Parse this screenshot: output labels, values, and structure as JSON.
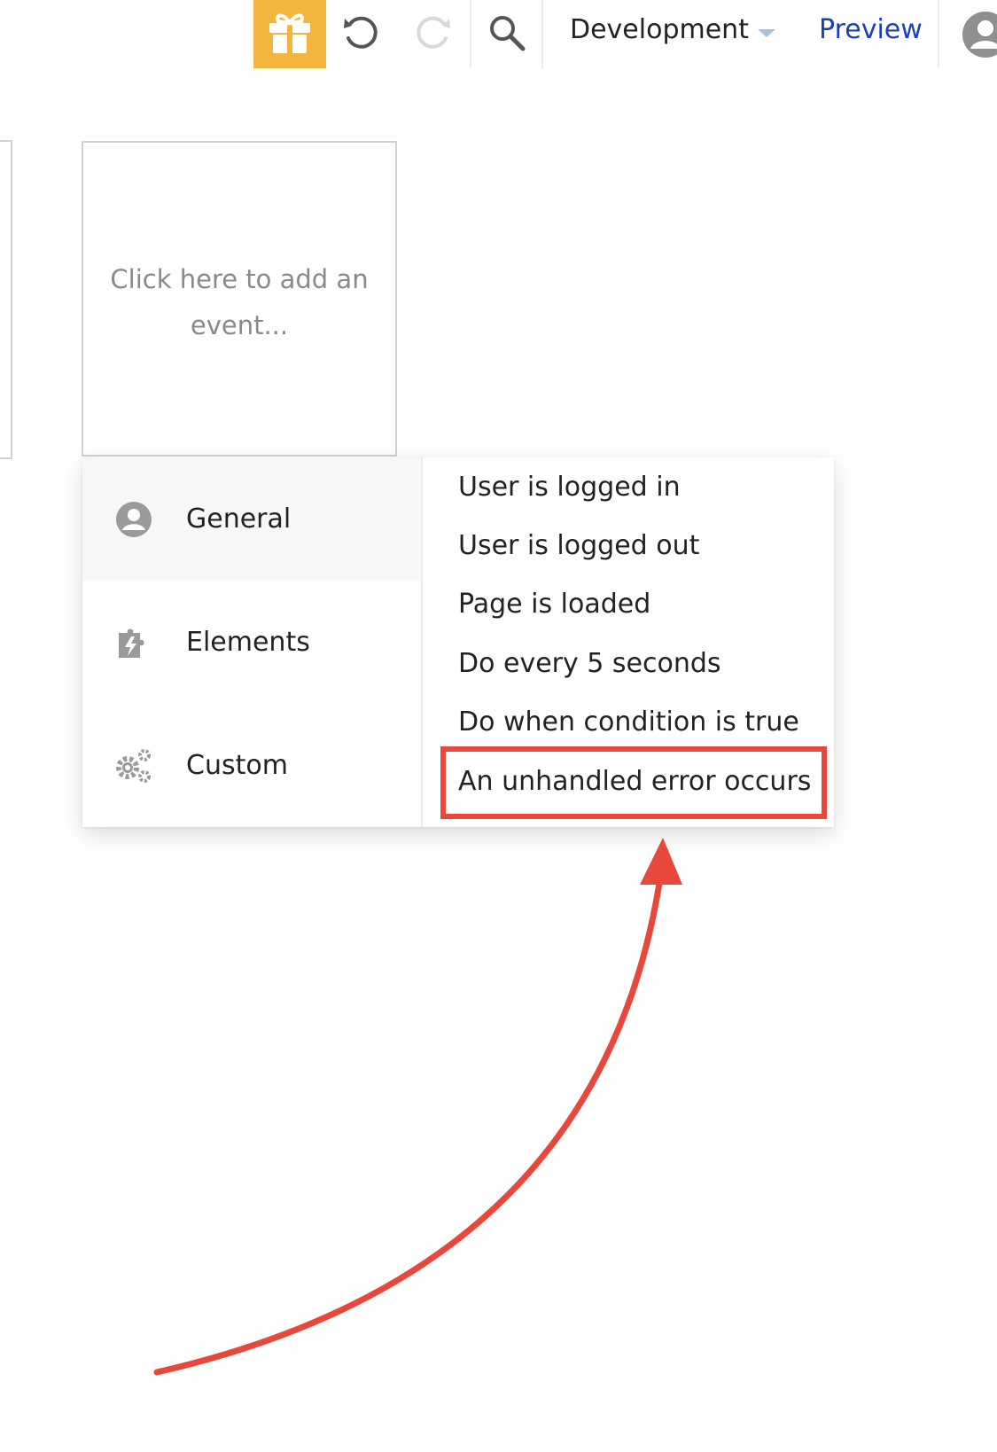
{
  "toolbar": {
    "gift_icon": "gift-icon",
    "undo_icon": "undo-icon",
    "redo_icon": "redo-icon",
    "search_icon": "search-icon",
    "environment": "Development",
    "preview": "Preview",
    "avatar_icon": "user-avatar-icon",
    "accent_color": "#f2b53d",
    "preview_color": "#1a3fb8"
  },
  "canvas": {
    "event_placeholder": "Click here to add an event..."
  },
  "menu": {
    "categories": [
      {
        "label": "General",
        "icon": "user-circle-icon",
        "active": true
      },
      {
        "label": "Elements",
        "icon": "puzzle-bolt-icon",
        "active": false
      },
      {
        "label": "Custom",
        "icon": "gears-icon",
        "active": false
      }
    ],
    "items": [
      {
        "label": "User is logged in"
      },
      {
        "label": "User is logged out"
      },
      {
        "label": "Page is loaded"
      },
      {
        "label": "Do every 5 seconds"
      },
      {
        "label": "Do when condition is true"
      },
      {
        "label": "An unhandled error occurs",
        "highlighted": true
      }
    ]
  },
  "annotation": {
    "color": "#e8483b"
  }
}
